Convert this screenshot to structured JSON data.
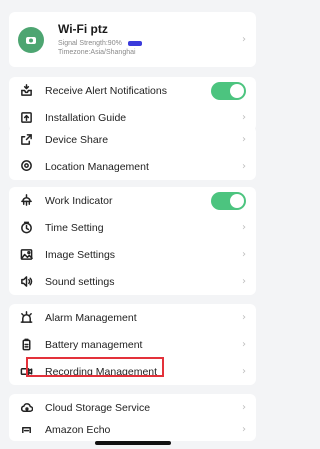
{
  "device": {
    "name": "Wi-Fi ptz",
    "signal_label": "Signal Strength:90%",
    "signal_percent": 90,
    "timezone": "Timezone:Asia/Shanghai"
  },
  "groups": [
    {
      "items": [
        {
          "label": "Receive Alert Notifications",
          "icon": "bell-tray-icon",
          "control": "toggle",
          "on": true
        },
        {
          "label": "Installation Guide",
          "icon": "upload-box-icon",
          "control": "chevron"
        }
      ]
    },
    {
      "items": [
        {
          "label": "Device Share",
          "icon": "share-icon",
          "control": "chevron"
        },
        {
          "label": "Location Management",
          "icon": "location-pin-icon",
          "control": "chevron"
        }
      ]
    },
    {
      "items": [
        {
          "label": "Work Indicator",
          "icon": "light-icon",
          "control": "toggle",
          "on": true
        },
        {
          "label": "Time Setting",
          "icon": "clock-icon",
          "control": "chevron"
        },
        {
          "label": "Image Settings",
          "icon": "image-icon",
          "control": "chevron"
        },
        {
          "label": "Sound settings",
          "icon": "speaker-icon",
          "control": "chevron"
        }
      ]
    },
    {
      "items": [
        {
          "label": "Alarm Management",
          "icon": "alarm-icon",
          "control": "chevron"
        },
        {
          "label": "Battery management",
          "icon": "battery-icon",
          "control": "chevron"
        },
        {
          "label": "Recording Management",
          "icon": "video-icon",
          "control": "chevron"
        }
      ]
    },
    {
      "items": [
        {
          "label": "Cloud Storage Service",
          "icon": "cloud-icon",
          "control": "chevron"
        },
        {
          "label": "Amazon Echo",
          "icon": "echo-icon",
          "control": "chevron"
        }
      ]
    }
  ],
  "chevron_glyph": "›",
  "colors": {
    "toggle_on": "#4cc47f",
    "highlight": "#e3313a",
    "background": "#f3f4f6"
  }
}
